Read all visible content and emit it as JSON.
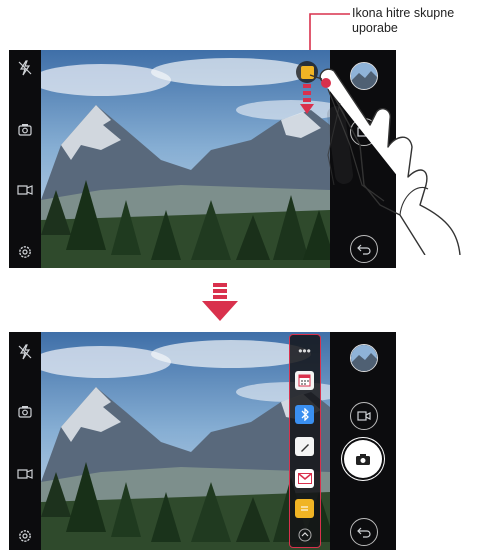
{
  "callout": {
    "label": "Ikona hitre skupne uporabe",
    "color": "#d9314d"
  },
  "camera_left_bar": {
    "icons": [
      "flash-off-icon",
      "switch-camera-icon",
      "mode-icon",
      "settings-icon"
    ]
  },
  "camera_right_bar": {
    "top_screen": [
      "gallery-thumbnail",
      "video-record-icon",
      "back-icon"
    ],
    "bottom_screen": [
      "gallery-thumbnail",
      "video-record-icon",
      "shutter-button",
      "back-icon"
    ]
  },
  "quick_share": {
    "apps": [
      "more-icon",
      "calendar-app-icon",
      "bluetooth-app-icon",
      "pen-app-icon",
      "email-app-icon",
      "memo-app-icon",
      "collapse-icon"
    ],
    "colors": {
      "share_icon": "#f0b424",
      "bluetooth": "#3a8ff0",
      "email": "#d9314d",
      "frame": "#d9314d"
    }
  },
  "transition_arrow": {
    "color": "#d9314d"
  }
}
